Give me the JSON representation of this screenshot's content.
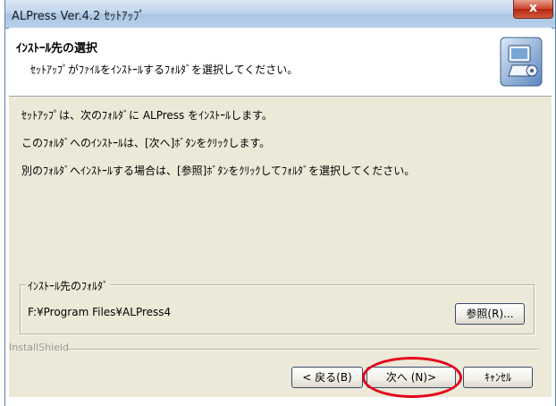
{
  "window": {
    "title": "ALPress Ver.4.2 ｾｯﾄｱｯﾌﾟ",
    "close_glyph": "x"
  },
  "header": {
    "title": "ｲﾝｽﾄｰﾙ先の選択",
    "subtitle": "ｾｯﾄｱｯﾌﾟがﾌｧｲﾙをｲﾝｽﾄｰﾙするﾌｫﾙﾀﾞを選択してください。",
    "icon": "setup-computer-icon"
  },
  "body": {
    "line1": "ｾｯﾄｱｯﾌﾟは、次のﾌｫﾙﾀﾞに ALPress をｲﾝｽﾄｰﾙします。",
    "line2": "このﾌｫﾙﾀﾞへのｲﾝｽﾄｰﾙは、[次へ]ﾎﾞﾀﾝをｸﾘｯｸします。",
    "line3": "別のﾌｫﾙﾀﾞへｲﾝｽﾄｰﾙする場合は、[参照]ﾎﾞﾀﾝをｸﾘｯｸしてﾌｫﾙﾀﾞを選択してください。"
  },
  "destination": {
    "group_label": "ｲﾝｽﾄｰﾙ先のﾌｫﾙﾀﾞ",
    "path": "F:¥Program Files¥ALPress4",
    "browse_label": "参照(R)..."
  },
  "footer": {
    "brand": "InstallShield",
    "back_label": "< 戻る(B)",
    "next_label": "次へ (N)>",
    "cancel_label": "ｷｬﾝｾﾙ"
  },
  "colors": {
    "highlight": "#e3001b"
  }
}
